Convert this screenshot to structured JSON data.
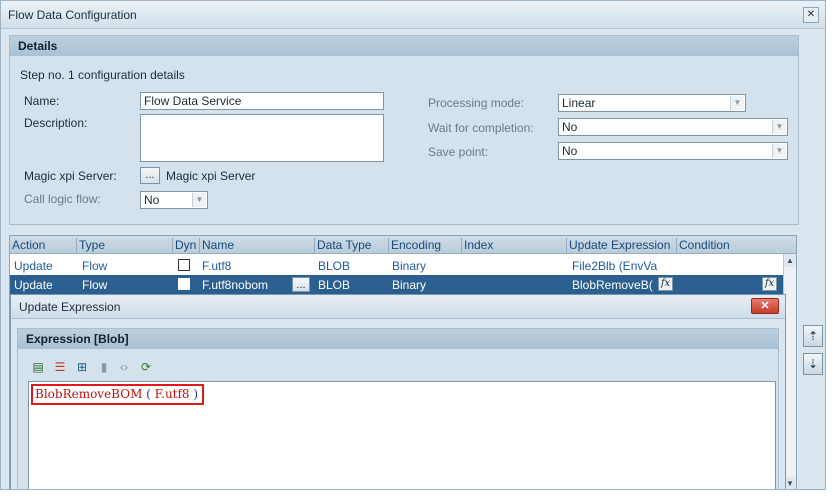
{
  "window": {
    "title": "Flow Data Configuration"
  },
  "details": {
    "header": "Details",
    "step_text": "Step no. 1 configuration details",
    "name_label": "Name:",
    "name_value": "Flow Data Service",
    "description_label": "Description:",
    "description_value": "",
    "server_label": "Magic xpi Server:",
    "server_value": "Magic xpi Server",
    "server_button": "...",
    "call_logic_label": "Call logic flow:",
    "call_logic_value": "No",
    "processing_mode_label": "Processing mode:",
    "processing_mode_value": "Linear",
    "wait_label": "Wait for completion:",
    "wait_value": "No",
    "save_point_label": "Save point:",
    "save_point_value": "No"
  },
  "grid": {
    "columns": [
      "Action",
      "Type",
      "Dyn",
      "Name",
      "Data Type",
      "Encoding",
      "Index",
      "Update Expression",
      "Condition"
    ],
    "rows": [
      {
        "action": "Update",
        "type": "Flow",
        "name": "F.utf8",
        "data_type": "BLOB",
        "encoding": "Binary",
        "index": "",
        "update_expression": "File2Blb (EnvVa",
        "condition": ""
      },
      {
        "action": "Update",
        "type": "Flow",
        "name": "F.utf8nobom",
        "name_button": "...",
        "data_type": "BLOB",
        "encoding": "Binary",
        "index": "",
        "update_expression": "BlobRemoveB(",
        "condition": ""
      }
    ]
  },
  "dialog": {
    "title": "Update Expression",
    "close": "✕",
    "expression_header": "Expression [Blob]",
    "code_func": "BlobRemoveBOM",
    "code_open": " ( ",
    "code_arg": "F.utf8",
    "code_close": " )"
  },
  "icons": {
    "fx": "fx"
  }
}
